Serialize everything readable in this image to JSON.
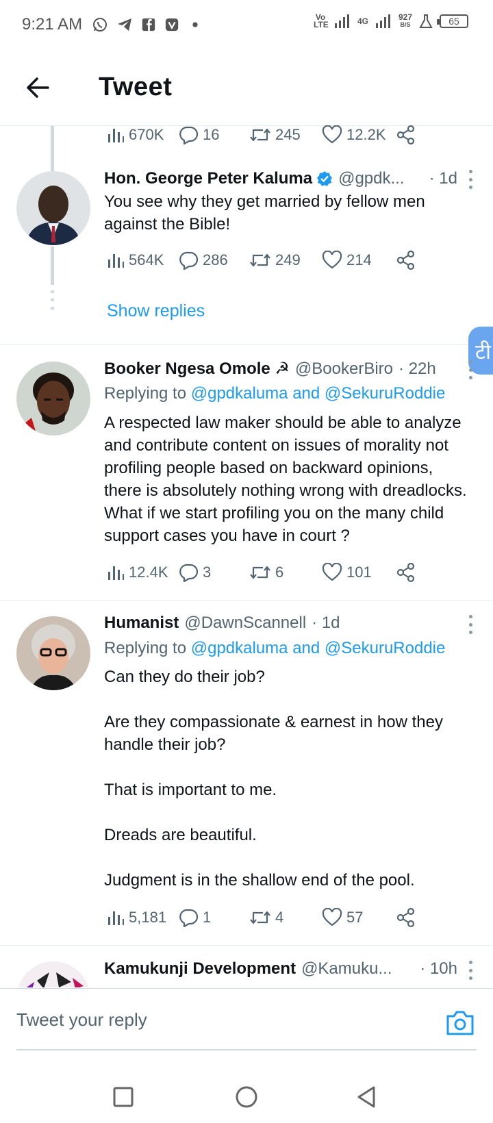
{
  "status_bar": {
    "time": "9:21 AM",
    "app_icons": [
      "whatsapp-icon",
      "telegram-icon",
      "facebook-icon",
      "vpn-icon",
      "dot-icon"
    ],
    "volte": "Vo LTE",
    "network": "4G",
    "speed_value": "927",
    "speed_unit": "B/S",
    "battery": "65"
  },
  "header": {
    "title": "Tweet"
  },
  "top_actions": {
    "views": "670K",
    "replies": "16",
    "retweets": "245",
    "likes": "12.2K"
  },
  "tweets": [
    {
      "name": "Hon. George Peter Kaluma",
      "verified": true,
      "handle": "@gpdk...",
      "time": "· 1d",
      "replying_prefix": "",
      "replying_to": "",
      "text": "You see why they get married by fellow men against the Bible!",
      "views": "564K",
      "replies": "286",
      "retweets": "249",
      "likes": "214"
    },
    {
      "name": "Booker Ngesa Omole ☭",
      "verified": false,
      "handle": "@BookerBiro",
      "time": "· 22h",
      "replying_prefix": "Replying to",
      "replying_to": "@gpdkaluma and @SekuruRoddie",
      "text": "A respected law maker should be able to analyze and contribute content on issues of morality not profiling people based on backward opinions, there is absolutely nothing wrong with dreadlocks. What if we start profiling you on the many child support cases you have in court ?",
      "views": "12.4K",
      "replies": "3",
      "retweets": "6",
      "likes": "101"
    },
    {
      "name": "Humanist",
      "verified": false,
      "handle": "@DawnScannell",
      "time": "· 1d",
      "replying_prefix": "Replying to",
      "replying_to": "@gpdkaluma and @SekuruRoddie",
      "text": "Can they do their job?\n\nAre they compassionate & earnest in how they handle their job?\n\nThat is important to me.\n\nDreads are beautiful.\n\nJudgment is in the shallow end of the pool.",
      "views": "5,181",
      "replies": "1",
      "retweets": "4",
      "likes": "57"
    },
    {
      "name": "Kamukunji Development",
      "verified": false,
      "handle": "@Kamuku...",
      "time": "· 10h"
    }
  ],
  "show_replies": "Show replies",
  "floating_button": "टी",
  "reply_bar": {
    "placeholder": "Tweet your reply"
  },
  "colors": {
    "accent": "#1d9bf0",
    "text": "#0f1419",
    "muted": "#536471",
    "border": "#e6ecf0"
  }
}
